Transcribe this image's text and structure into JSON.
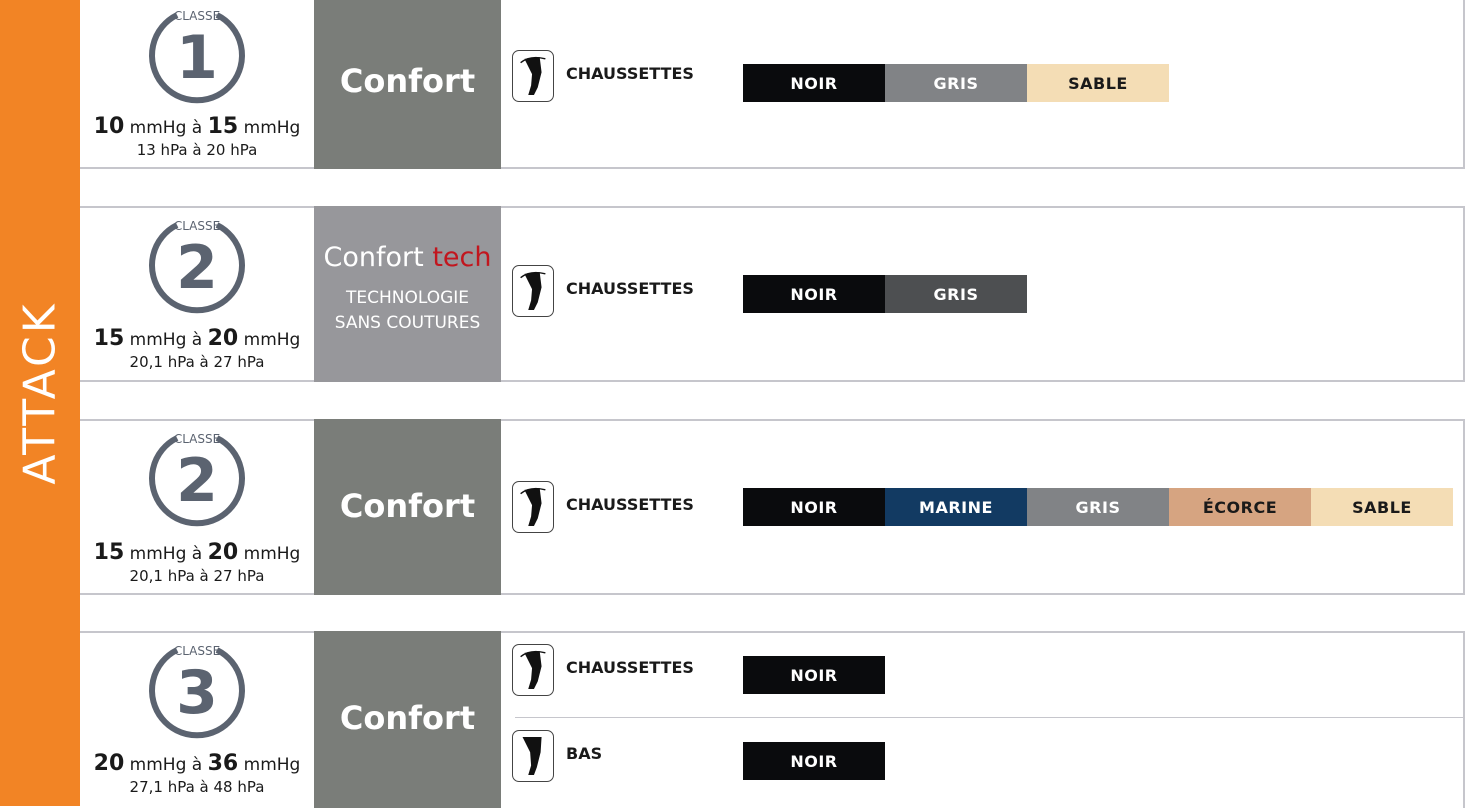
{
  "brand": "ATTACK",
  "colors": {
    "sidebar": "#f28425",
    "confort_bg": "#7a7d79",
    "tech_bg": "#97979b",
    "noir": "#0a0b0d",
    "gris_light": "#818386",
    "gris_dark": "#4d4f51",
    "sable": "#f4ddb5",
    "marine": "#123a62",
    "ecorce": "#d6a481",
    "badge": "#5b6370"
  },
  "rows": [
    {
      "classe_label": "CLASSE",
      "classe_number": "1",
      "mmhg_low": "10",
      "mmhg_high": "15",
      "mmhg_unit": "mmHg",
      "a": "à",
      "hpa_text": "13 hPa à 20 hPa",
      "range_title": "Confort",
      "products": [
        {
          "icon": "sock-leg-icon",
          "label": "CHAUSSETTES",
          "colors": [
            {
              "label": "NOIR",
              "bg": "#0a0b0d",
              "fg": "#ffffff"
            },
            {
              "label": "GRIS",
              "bg": "#818386",
              "fg": "#ffffff"
            },
            {
              "label": "SABLE",
              "bg": "#f4ddb5",
              "fg": "#1a1a1a"
            }
          ]
        }
      ]
    },
    {
      "classe_label": "CLASSE",
      "classe_number": "2",
      "mmhg_low": "15",
      "mmhg_high": "20",
      "mmhg_unit": "mmHg",
      "a": "à",
      "hpa_text": "20,1 hPa à 27 hPa",
      "range_title_a": "Confort ",
      "range_title_b": "tech",
      "range_sub_1": "TECHNOLOGIE",
      "range_sub_2": "SANS COUTURES",
      "products": [
        {
          "icon": "sock-leg-icon",
          "label": "CHAUSSETTES",
          "colors": [
            {
              "label": "NOIR",
              "bg": "#0a0b0d",
              "fg": "#ffffff"
            },
            {
              "label": "GRIS",
              "bg": "#4d4f51",
              "fg": "#ffffff"
            }
          ]
        }
      ]
    },
    {
      "classe_label": "CLASSE",
      "classe_number": "2",
      "mmhg_low": "15",
      "mmhg_high": "20",
      "mmhg_unit": "mmHg",
      "a": "à",
      "hpa_text": "20,1 hPa à 27 hPa",
      "range_title": "Confort",
      "products": [
        {
          "icon": "sock-leg-icon",
          "label": "CHAUSSETTES",
          "colors": [
            {
              "label": "NOIR",
              "bg": "#0a0b0d",
              "fg": "#ffffff"
            },
            {
              "label": "MARINE",
              "bg": "#123a62",
              "fg": "#ffffff"
            },
            {
              "label": "GRIS",
              "bg": "#818386",
              "fg": "#ffffff"
            },
            {
              "label": "ÉCORCE",
              "bg": "#d6a481",
              "fg": "#1a1a1a"
            },
            {
              "label": "SABLE",
              "bg": "#f4ddb5",
              "fg": "#1a1a1a"
            }
          ]
        }
      ]
    },
    {
      "classe_label": "CLASSE",
      "classe_number": "3",
      "mmhg_low": "20",
      "mmhg_high": "36",
      "mmhg_unit": "mmHg",
      "a": "à",
      "hpa_text": "27,1 hPa à 48 hPa",
      "range_title": "Confort",
      "products": [
        {
          "icon": "sock-leg-icon",
          "label": "CHAUSSETTES",
          "colors": [
            {
              "label": "NOIR",
              "bg": "#0a0b0d",
              "fg": "#ffffff"
            }
          ]
        },
        {
          "icon": "stocking-leg-icon",
          "label": "BAS",
          "colors": [
            {
              "label": "NOIR",
              "bg": "#0a0b0d",
              "fg": "#ffffff"
            }
          ]
        }
      ]
    }
  ]
}
